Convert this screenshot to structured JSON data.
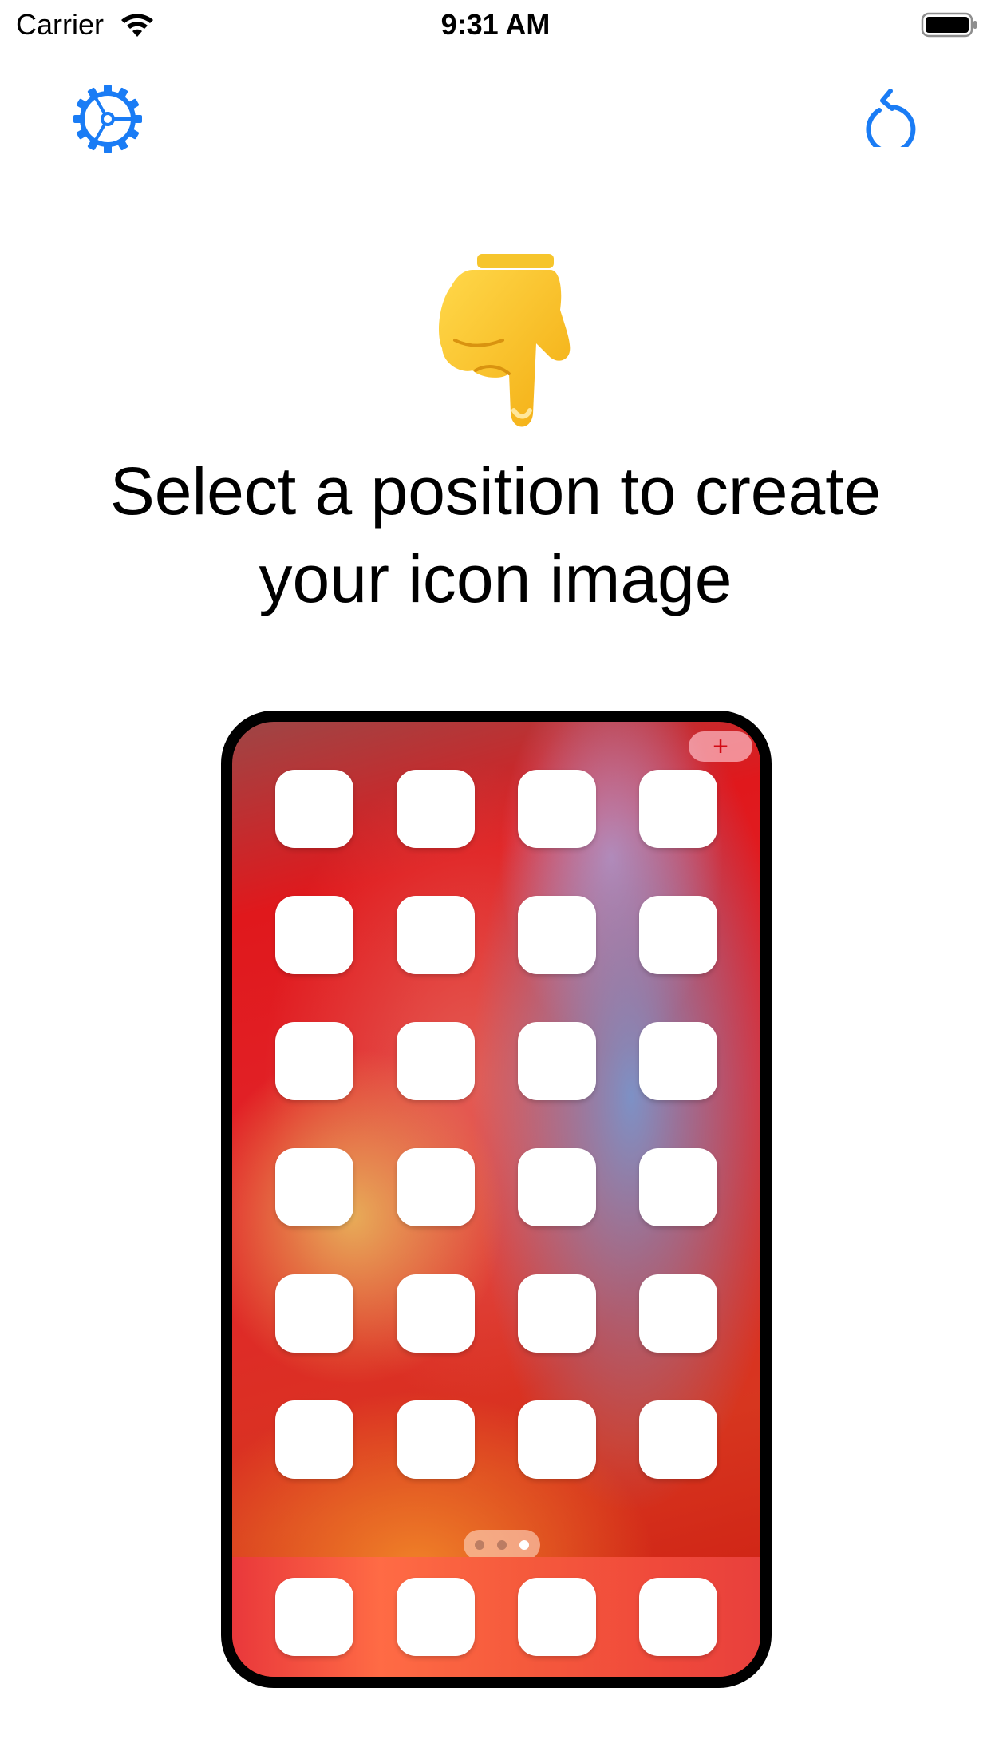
{
  "status_bar": {
    "carrier": "Carrier",
    "time": "9:31 AM",
    "wifi_icon": "wifi-icon",
    "battery_icon": "battery-full-icon"
  },
  "toolbar": {
    "settings_icon": "gear-icon",
    "reset_icon": "rotate-counterclockwise-icon",
    "accent_color": "#1a7cf5"
  },
  "prompt": {
    "emoji": "👇",
    "emoji_icon": "pointing-down-hand-icon",
    "text": "Select a position to create your icon image"
  },
  "phone_preview": {
    "add_button_label": "+",
    "grid": {
      "rows": 6,
      "columns": 4
    },
    "page_indicator": {
      "count": 3,
      "active_index": 2
    },
    "dock": {
      "slots": 4
    }
  }
}
